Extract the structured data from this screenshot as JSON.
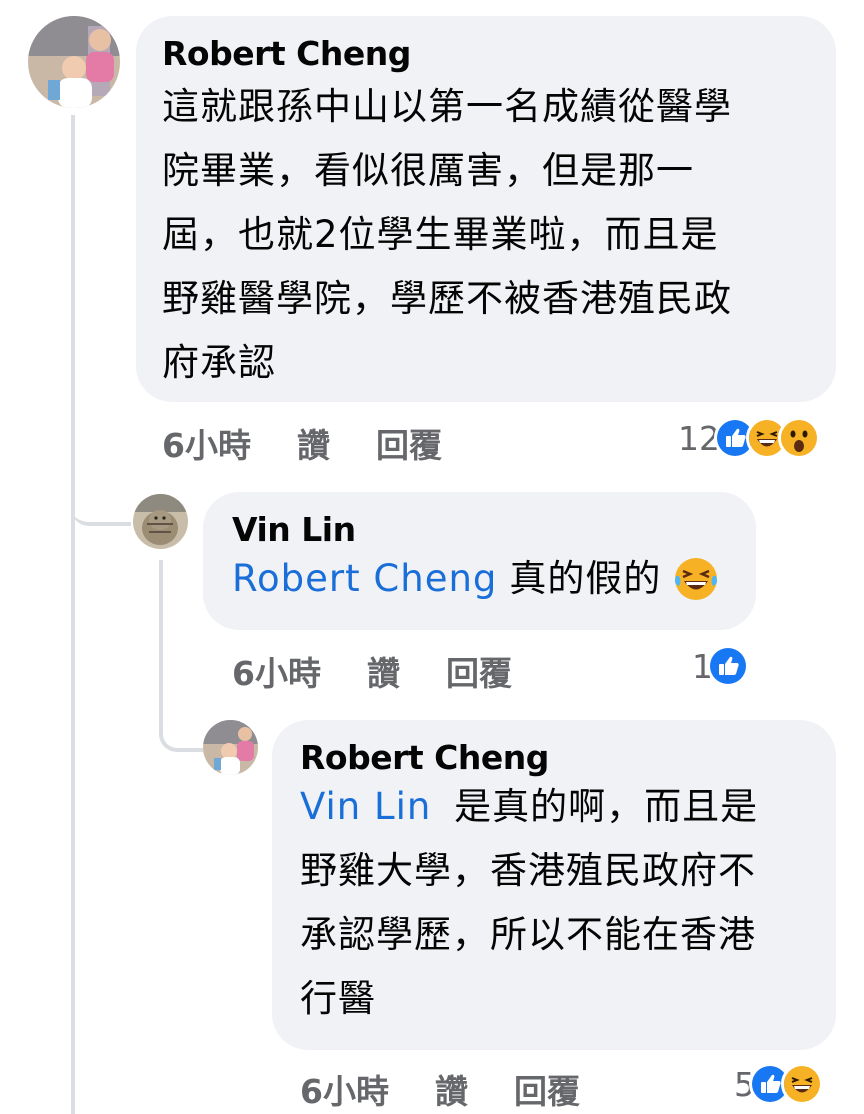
{
  "comments": [
    {
      "author": "Robert Cheng",
      "text": "這就跟孫中山以第一名成績從醫學院畢業，看似很厲害，但是那一屆，也就2位學生畢業啦，而且是野雞醫學院，學歷不被香港殖民政府承認",
      "lines": [
        "這就跟孫中山以第一名成績從醫學",
        "院畢業，看似很厲害，但是那一",
        "屆，也就2位學生畢業啦，而且是",
        "野雞醫學院，學歷不被香港殖民政",
        "府承認"
      ],
      "time": "6小時",
      "like_label": "讚",
      "reply_label": "回覆",
      "reaction_count": "12",
      "reactions": [
        "like-icon",
        "haha-icon",
        "wow-icon"
      ]
    },
    {
      "author": "Vin Lin",
      "mention": "Robert Cheng",
      "text": "真的假的",
      "emoji": "face-with-tears-of-joy",
      "time": "6小時",
      "like_label": "讚",
      "reply_label": "回覆",
      "reaction_count": "1",
      "reactions": [
        "like-icon"
      ]
    },
    {
      "author": "Robert Cheng",
      "mention": "Vin Lin",
      "line1": "是真的啊，而且是",
      "lines": [
        "野雞大學，香港殖民政府不",
        "承認學歷，所以不能在香港",
        "行醫"
      ],
      "time": "6小時",
      "like_label": "讚",
      "reply_label": "回覆",
      "reaction_count": "5",
      "reactions": [
        "like-icon",
        "haha-icon"
      ]
    }
  ],
  "colors": {
    "bubble": "#f0f2f5",
    "mention": "#1a6ed8",
    "meta": "#65676b",
    "like": "#1877f2",
    "thread_line": "#dadde1"
  }
}
